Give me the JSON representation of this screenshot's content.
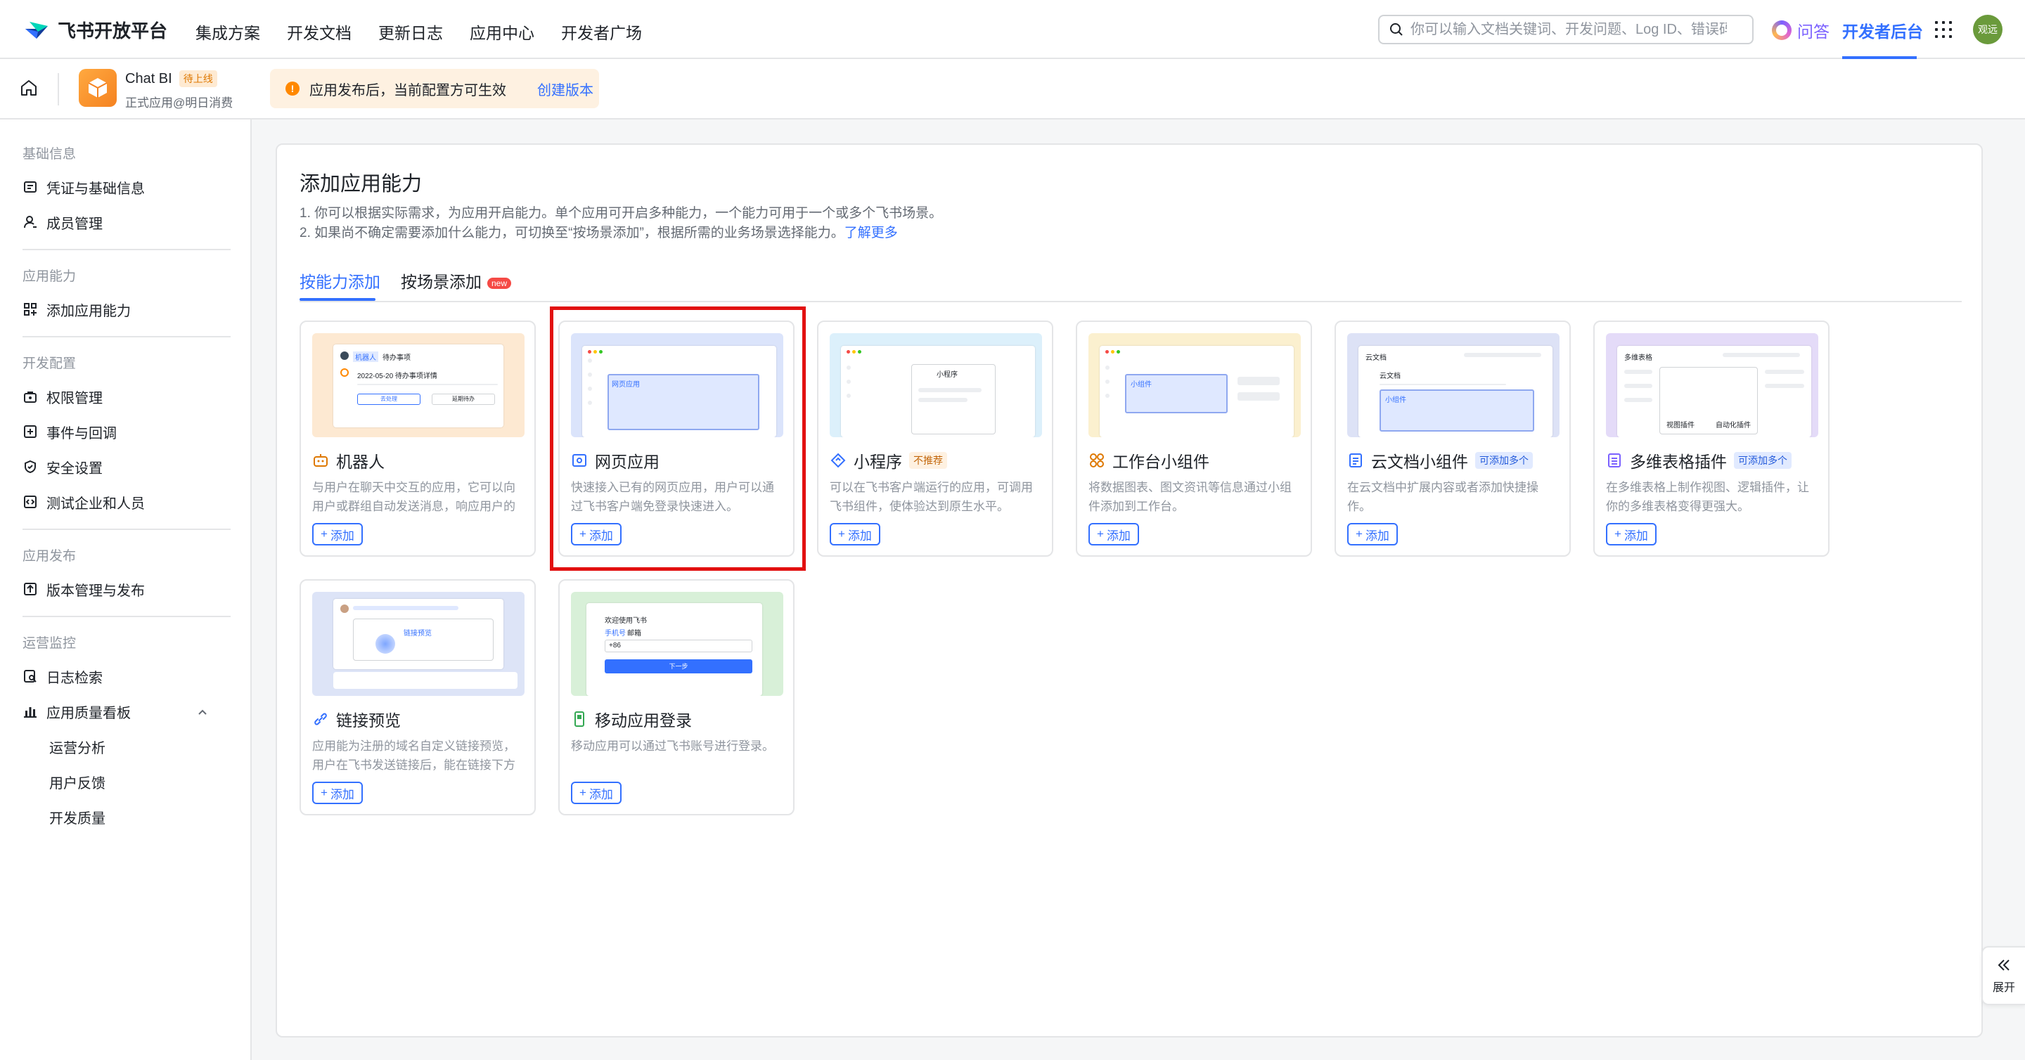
{
  "brand": {
    "name": "飞书开放平台"
  },
  "nav": {
    "links": [
      "集成方案",
      "开发文档",
      "更新日志",
      "应用中心",
      "开发者广场"
    ]
  },
  "search": {
    "placeholder": "你可以输入文档关键词、开发问题、Log ID、错误码"
  },
  "header": {
    "ask": "问答",
    "dev_backend": "开发者后台",
    "avatar": "观远"
  },
  "app": {
    "name": "Chat BI",
    "status": "待上线",
    "sub": "正式应用@明日消费"
  },
  "notice": {
    "text": "应用发布后，当前配置方可生效",
    "link": "创建版本"
  },
  "sidebar": {
    "groups": [
      {
        "label": "基础信息",
        "items": [
          "凭证与基础信息",
          "成员管理"
        ]
      },
      {
        "label": "应用能力",
        "items": [
          "添加应用能力"
        ]
      },
      {
        "label": "开发配置",
        "items": [
          "权限管理",
          "事件与回调",
          "安全设置",
          "测试企业和人员"
        ]
      },
      {
        "label": "应用发布",
        "items": [
          "版本管理与发布"
        ]
      },
      {
        "label": "运营监控",
        "items": [
          "日志检索",
          "应用质量看板"
        ]
      }
    ],
    "subitems": [
      "运营分析",
      "用户反馈",
      "开发质量"
    ]
  },
  "main": {
    "title": "添加应用能力",
    "desc1": "1. 你可以根据实际需求，为应用开启能力。单个应用可开启多种能力，一个能力可用于一个或多个飞书场景。",
    "desc2": "2. 如果尚不确定需要添加什么能力，可切换至“按场景添加”，根据所需的业务场景选择能力。",
    "learn_more": "了解更多",
    "tabs": [
      "按能力添加",
      "按场景添加"
    ],
    "new_badge": "new",
    "add_label": "添加"
  },
  "cards": [
    {
      "title": "机器人",
      "desc": "与用户在聊天中交互的应用，它可以向用户或群组自动发送消息，响应用户的消...",
      "icon": "robot-icon",
      "tag": ""
    },
    {
      "title": "网页应用",
      "desc": "快速接入已有的网页应用，用户可以通过飞书客户端免登录快速进入。",
      "icon": "webpage-icon",
      "tag": ""
    },
    {
      "title": "小程序",
      "desc": "可以在飞书客户端运行的应用，可调用飞书组件，使体验达到原生水平。",
      "icon": "miniprogram-icon",
      "tag": "不推荐"
    },
    {
      "title": "工作台小组件",
      "desc": "将数据图表、图文资讯等信息通过小组件添加到工作台。",
      "icon": "widget-icon",
      "tag": ""
    },
    {
      "title": "云文档小组件",
      "desc": "在云文档中扩展内容或者添加快捷操作。",
      "icon": "doc-icon",
      "tag": "可添加多个"
    },
    {
      "title": "多维表格插件",
      "desc": "在多维表格上制作视图、逻辑插件，让你的多维表格变得更强大。",
      "icon": "bitable-icon",
      "tag": "可添加多个"
    },
    {
      "title": "链接预览",
      "desc": "应用能为注册的域名自定义链接预览，用户在飞书发送链接后，能在链接下方展示...",
      "icon": "link-icon",
      "tag": ""
    },
    {
      "title": "移动应用登录",
      "desc": "移动应用可以通过飞书账号进行登录。",
      "icon": "mobile-icon",
      "tag": ""
    }
  ],
  "thumbs": {
    "robot": {
      "chip": "机器人",
      "chip2": "待办事项",
      "date": "2022-05-20 待办事项详情",
      "btn1": "去处理",
      "btn2": "延期待办"
    },
    "web": {
      "label": "网页应用"
    },
    "mini": {
      "label": "小程序"
    },
    "widget": {
      "label": "小组件"
    },
    "doc": {
      "label": "云文档",
      "widget": "小组件"
    },
    "bitable": {
      "label": "多维表格",
      "p1": "视图插件",
      "p2": "自动化插件"
    },
    "link": {
      "text": "链接预览"
    },
    "mobile": {
      "title": "欢迎使用飞书",
      "tab1": "手机号",
      "tab2": "邮箱",
      "code": "+86",
      "btn": "下一步"
    }
  },
  "expand": {
    "label": "展开"
  },
  "colors": {
    "accent": "#3370ff",
    "highlight": "#e21010",
    "warning": "#ff8800"
  }
}
